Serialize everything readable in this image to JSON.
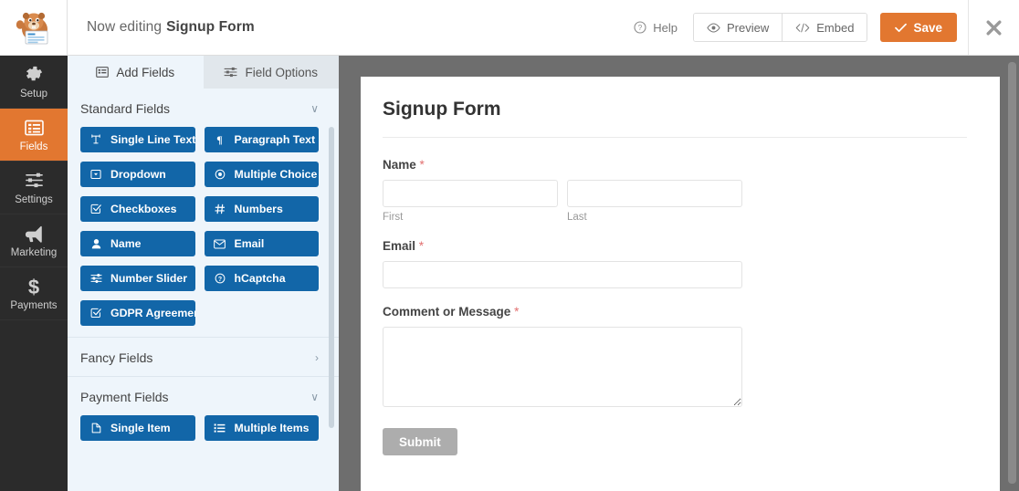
{
  "header": {
    "logo_name": "wpforms-beaver-logo",
    "editing_prefix": "Now editing",
    "form_name": "Signup Form",
    "help_label": "Help",
    "preview_label": "Preview",
    "embed_label": "Embed",
    "save_label": "Save",
    "close_label": "✖",
    "accent_orange": "#e27730"
  },
  "sidebar": {
    "items": [
      {
        "label": "Setup",
        "icon": "gear-icon",
        "active": false
      },
      {
        "label": "Fields",
        "icon": "list-icon",
        "active": true
      },
      {
        "label": "Settings",
        "icon": "sliders-icon",
        "active": false
      },
      {
        "label": "Marketing",
        "icon": "megaphone-icon",
        "active": false
      },
      {
        "label": "Payments",
        "icon": "dollar-icon",
        "active": false
      }
    ]
  },
  "panel": {
    "tabs": [
      {
        "label": "Add Fields",
        "icon": "add-fields-icon",
        "active": true
      },
      {
        "label": "Field Options",
        "icon": "field-options-icon",
        "active": false
      }
    ],
    "sections": [
      {
        "title": "Standard Fields",
        "chevron": "∨",
        "expanded": true,
        "fields": [
          {
            "label": "Single Line Text",
            "icon": "text-icon"
          },
          {
            "label": "Paragraph Text",
            "icon": "paragraph-icon"
          },
          {
            "label": "Dropdown",
            "icon": "dropdown-icon"
          },
          {
            "label": "Multiple Choice",
            "icon": "radio-icon"
          },
          {
            "label": "Checkboxes",
            "icon": "checkbox-icon"
          },
          {
            "label": "Numbers",
            "icon": "hash-icon"
          },
          {
            "label": "Name",
            "icon": "user-icon"
          },
          {
            "label": "Email",
            "icon": "envelope-icon"
          },
          {
            "label": "Number Slider",
            "icon": "slider-icon"
          },
          {
            "label": "hCaptcha",
            "icon": "question-circle-icon"
          },
          {
            "label": "GDPR Agreement",
            "icon": "checkbox-icon"
          }
        ]
      },
      {
        "title": "Fancy Fields",
        "chevron": "›",
        "expanded": false,
        "fields": []
      },
      {
        "title": "Payment Fields",
        "chevron": "∨",
        "expanded": true,
        "fields": [
          {
            "label": "Single Item",
            "icon": "file-icon"
          },
          {
            "label": "Multiple Items",
            "icon": "list-ul-icon"
          }
        ]
      }
    ]
  },
  "form_preview": {
    "title": "Signup Form",
    "required_mark": "*",
    "fields": [
      {
        "type": "name",
        "label": "Name",
        "required": true,
        "subfields": [
          {
            "value": "",
            "sublabel": "First"
          },
          {
            "value": "",
            "sublabel": "Last"
          }
        ]
      },
      {
        "type": "email",
        "label": "Email",
        "required": true,
        "value": ""
      },
      {
        "type": "textarea",
        "label": "Comment or Message",
        "required": true,
        "value": ""
      }
    ],
    "submit_label": "Submit"
  }
}
